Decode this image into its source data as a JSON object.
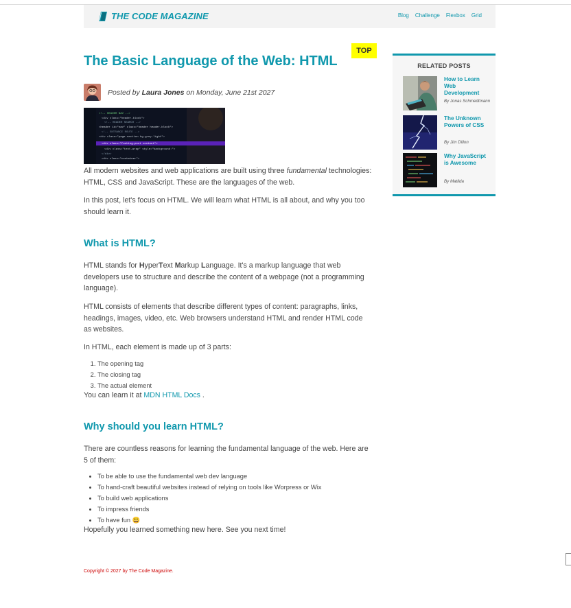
{
  "header": {
    "logo_text": "THE CODE MAGAZINE",
    "nav": [
      "Blog",
      "Challenge",
      "Flexbox",
      "Grid"
    ]
  },
  "post": {
    "badge": "TOP",
    "title": "The Basic Language of the Web: HTML",
    "posted_by_prefix": "Posted by ",
    "author": "Laura Jones",
    "date_text": " on Monday, June 21st 2027",
    "intro_p1_a": "All modern websites and web applications are built using three ",
    "intro_p1_em": "fundamental",
    "intro_p1_b": " technologies: HTML, CSS and JavaScript. These are the languages of the web.",
    "intro_p2": "In this post, let's focus on HTML. We will learn what HTML is all about, and why you too should learn it.",
    "section1": {
      "heading": "What is HTML?",
      "p1": {
        "a": "HTML stands for ",
        "h": "H",
        "yper": "yper",
        "t": "T",
        "ext": "ext ",
        "m": "M",
        "arkup": "arkup ",
        "l": "L",
        "anguage": "anguage",
        "rest": ". It's a markup language that web developers use to structure and describe the content of a webpage (not a programming language)."
      },
      "p2": "HTML consists of elements that describe different types of content: paragraphs, links, headings, images, video, etc. Web browsers understand HTML and render HTML code as websites.",
      "p3": "In HTML, each element is made up of 3 parts:",
      "parts": [
        "The opening tag",
        "The closing tag",
        "The actual element"
      ],
      "learn_prefix": "You can learn it at ",
      "learn_link": "MDN HTML Docs",
      "learn_suffix": " ."
    },
    "section2": {
      "heading": "Why should you learn HTML?",
      "p1": "There are countless reasons for learning the fundamental language of the web. Here are 5 of them:",
      "reasons": [
        "To be able to use the fundamental web dev language",
        "To hand-craft beautiful websites instead of relying on tools like Worpress or Wix",
        "To build web applications",
        "To impress friends",
        "To have fun 😃"
      ],
      "closing": "Hopefully you learned something new here. See you next time!"
    }
  },
  "sidebar": {
    "title": "RELATED POSTS",
    "posts": [
      {
        "title": "How to Learn Web Development",
        "author": "By Jonas Schmedtmann"
      },
      {
        "title": "The Unknown Powers of CSS",
        "author": "By Jim Dillon"
      },
      {
        "title": "Why JavaScript is Awesome",
        "author": "By Matilda"
      }
    ]
  },
  "footer": {
    "copyright": "Copyright © 2027 by The Code Magazine."
  },
  "colors": {
    "accent": "#1098ad",
    "badge": "#ffff00",
    "copyright": "#cc0000"
  }
}
